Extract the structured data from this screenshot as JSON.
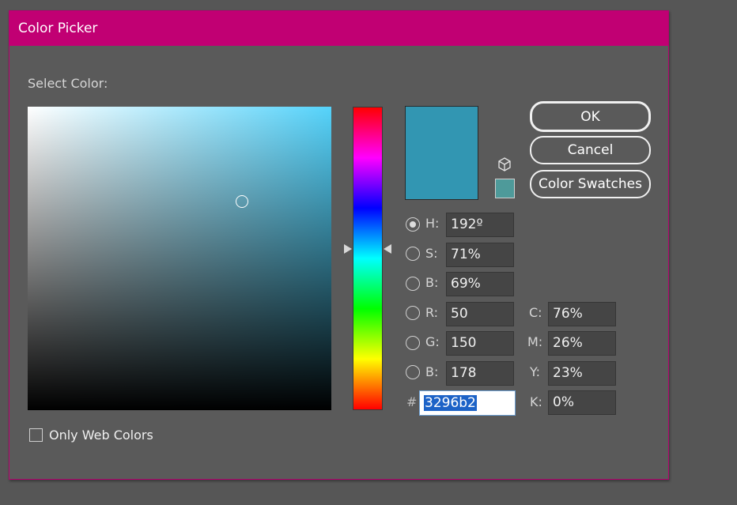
{
  "window": {
    "title": "Color Picker"
  },
  "select_label": "Select Color:",
  "only_web_colors": {
    "label": "Only Web Colors",
    "checked": false
  },
  "current_color": "#3296b2",
  "web_safe_color": "#4e9a9a",
  "picker_hue_color": "#55d3fb",
  "buttons": {
    "ok": "OK",
    "cancel": "Cancel",
    "swatches": "Color Swatches"
  },
  "hsb": [
    {
      "key": "H:",
      "value": "192º",
      "selected": true
    },
    {
      "key": "S:",
      "value": "71%",
      "selected": false
    },
    {
      "key": "B:",
      "value": "69%",
      "selected": false
    }
  ],
  "rgb": [
    {
      "key": "R:",
      "value": "50",
      "selected": false
    },
    {
      "key": "G:",
      "value": "150",
      "selected": false
    },
    {
      "key": "B:",
      "value": "178",
      "selected": false
    }
  ],
  "cmyk": [
    {
      "key": "C:",
      "value": "76%"
    },
    {
      "key": "M:",
      "value": "26%"
    },
    {
      "key": "Y:",
      "value": "23%"
    },
    {
      "key": "K:",
      "value": "0%"
    }
  ],
  "hex": {
    "prefix": "#",
    "value": "3296b2"
  }
}
